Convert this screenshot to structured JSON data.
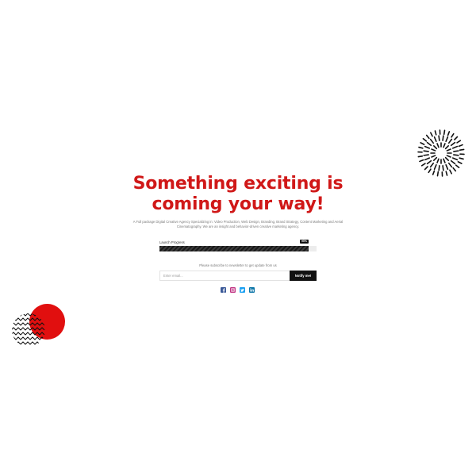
{
  "hero": {
    "headline": "Something exciting is coming your way!",
    "description": "A Full package Digital Creative Agency Specializing in: Video Production, Web Design, Branding, Brand Strategy, Content Marketing and Aerial Cinematography. We are an insight and behavior-driven creative marketing agency."
  },
  "progress": {
    "label": "Launch Progress",
    "percent_text": "95%",
    "value": 0.95
  },
  "newsletter": {
    "prompt": "Please subscribe to newsletter to get update from us",
    "email_placeholder": "Enter email...",
    "button_label": "Notify me!"
  },
  "social": {
    "icons": [
      "facebook-icon",
      "instagram-icon",
      "twitter-icon",
      "linkedin-icon"
    ],
    "colors": {
      "facebook": "#3b5998",
      "instagram": "#c13584",
      "twitter": "#1da1f2",
      "linkedin": "#0e76a8"
    }
  },
  "colors": {
    "accent": "#d01818",
    "decor_circle": "#e10f0f",
    "button": "#111111"
  }
}
